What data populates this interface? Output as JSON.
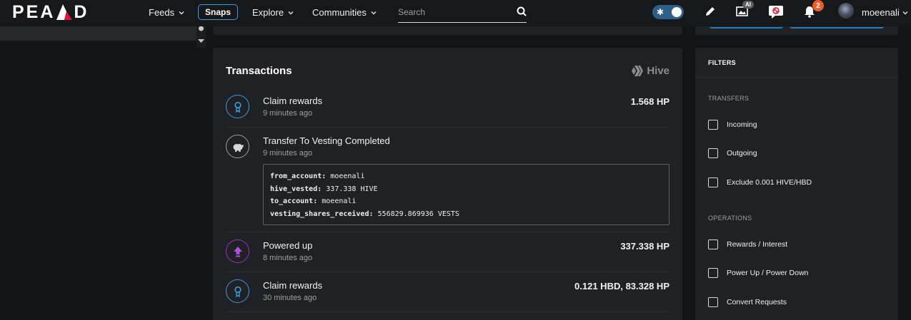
{
  "nav": {
    "logo_left": "PEA",
    "logo_right": "D",
    "feeds": "Feeds",
    "snaps": "Snaps",
    "explore": "Explore",
    "communities": "Communities",
    "search_placeholder": "Search",
    "ai_badge": "AI",
    "notification_count": "2",
    "username": "moeenali"
  },
  "transactions": {
    "title": "Transactions",
    "network": "Hive",
    "items": [
      {
        "name": "Claim rewards",
        "time": "9 minutes ago",
        "amount": "1.568 HP",
        "icon": "reward-icon"
      },
      {
        "name": "Transfer To Vesting Completed",
        "time": "9 minutes ago",
        "amount": "",
        "icon": "piggy-bank-icon",
        "details": [
          {
            "key": "from_account:",
            "value": "moeenali"
          },
          {
            "key": "hive_vested:",
            "value": "337.338 HIVE"
          },
          {
            "key": "to_account:",
            "value": "moeenali"
          },
          {
            "key": "vesting_shares_received:",
            "value": "556829.869936 VESTS"
          }
        ]
      },
      {
        "name": "Powered up",
        "time": "8 minutes ago",
        "amount": "337.338 HP",
        "icon": "power-up-icon"
      },
      {
        "name": "Claim rewards",
        "time": "30 minutes ago",
        "amount": "0.121 HBD, 83.328 HP",
        "icon": "reward-icon"
      }
    ]
  },
  "filters": {
    "title": "FILTERS",
    "transfers_label": "TRANSFERS",
    "transfers": [
      "Incoming",
      "Outgoing",
      "Exclude 0.001 HIVE/HBD"
    ],
    "operations_label": "OPERATIONS",
    "operations": [
      "Rewards / Interest",
      "Power Up / Power Down",
      "Convert Requests"
    ]
  },
  "colors": {
    "accent": "#3b9ddd",
    "powerup": "#9b2fc4",
    "notification": "#f25b2a",
    "background": "#131416",
    "card": "#1f2124"
  }
}
